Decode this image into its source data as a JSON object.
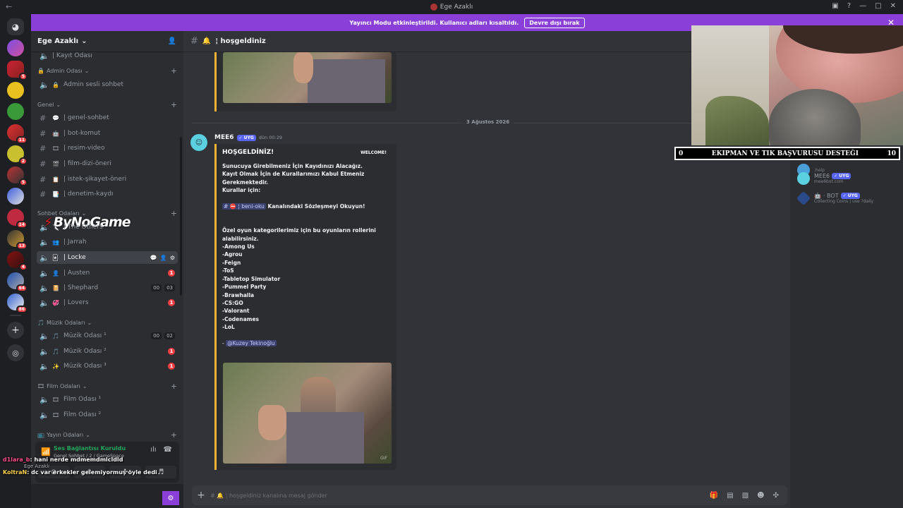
{
  "window": {
    "title": "Ege Azaklı"
  },
  "banner": {
    "text": "Yayıncı Modu etkinleştirildi. Kullanıcı adları kısaltıldı.",
    "button": "Devre dışı bırak"
  },
  "server": {
    "name": "Ege Azaklı"
  },
  "guild_badges": [
    "5",
    "11",
    "2",
    "5",
    "14",
    "13",
    "4",
    "64",
    "86"
  ],
  "categories": {
    "admin": "Admin Odası",
    "genel": "Genel",
    "sohbet": "Sohbet Odaları",
    "muzik": "Müzik Odaları",
    "film": "Film Odaları",
    "yayin": "Yayın Odaları"
  },
  "channels": {
    "kayit": "| Kayıt Odası",
    "admin_sesli": "Admin sesli sohbet",
    "genel_sohbet": "| genel-sohbet",
    "bot_komut": "| bot-komut",
    "resim_video": "| resim-video",
    "film_dizi": "| film-dizi-öneri",
    "istek": "| istek-şikayet-öneri",
    "denetim": "| denetim-kaydı",
    "the_others": "| The Others",
    "jarrah": "| Jarrah",
    "locke": "| Locke",
    "austen": "| Austen",
    "shephard": "| Shephard",
    "lovers": "| Lovers",
    "muzik1": "Müzik Odası ¹",
    "muzik2": "Müzik Odası ²",
    "muzik3": "Müzik Odası ³",
    "film1": "Film Odası ¹",
    "film2": "Film Odası ²"
  },
  "channel_badges": {
    "austen": "1",
    "shephard_a": "00",
    "shephard_b": "03",
    "lovers": "1",
    "muzik1_a": "00",
    "muzik1_b": "02",
    "muzik2": "1",
    "muzik3": "1"
  },
  "watermark": "ByNoGame",
  "voice": {
    "status": "Ses Bağlantısı Kuruldu",
    "sub": "Genel Sohbet / 2 / GameSpace"
  },
  "stream_chat": [
    {
      "user": "d1lara_b",
      "text": ": hani nerde mdmemdmlcldld"
    },
    {
      "user": "KoltraN",
      "text": ": dc var erkekler gelemiyormuş öyle dedi"
    }
  ],
  "user_bar": {
    "name": "Ege Azaklı"
  },
  "channel_header": {
    "name": "¦ hoşgeldiniz"
  },
  "date_divider": "3 Ağustos 2026",
  "message": {
    "author": "MEE6",
    "tag": "UYG",
    "time": "dün 00:29",
    "embed_title": "HOŞGELDİNİZ!",
    "embed_thumb": "WELCOME!",
    "body_1": "Sunucuya Girebilmeniz İçin Kayıdınızı Alacağız.\nKayıt Olmak İçin de Kurallarımızı Kabul Etmeniz Gerekmektedir.\nKurallar için:",
    "channel_mention": "# ⛔ ¦ beni-oku",
    "body_2": " Kanalındaki Sözleşmeyi Okuyun!",
    "body_3": "Özel oyun kategorilerimiz için bu oyunların rollerini alabilirsiniz.\n-Among Us\n-Agrou\n-Feign\n-ToS\n-Tabletop Simulator\n-Pummel Party\n-Brawhalla\n-CS:GO\n-Valorant\n-Codenames\n-LoL",
    "signature_dash": "- ",
    "signature": "@Kuzey Tekinoğlu"
  },
  "composer": {
    "placeholder": "# 🔔 ¦ hoşgeldiniz kanalına mesaj gönder"
  },
  "members": [
    {
      "name": "MEE6",
      "tag": "UYG",
      "status": "mee6bot.com"
    },
    {
      "name": "· BOT",
      "tag": "UYG",
      "status": "Collecting Coins | use ?daily"
    }
  ],
  "member_partial": ".help",
  "ticker": {
    "left": "0",
    "text": "EKIPMAN VE TIK BAŞVURUSU DESTEĞI",
    "right": "10"
  },
  "colors": {
    "accent": "#8b3fd9",
    "embed_border": "#f0b232",
    "voice_green": "#23a55a",
    "badge_red": "#f23f43"
  }
}
